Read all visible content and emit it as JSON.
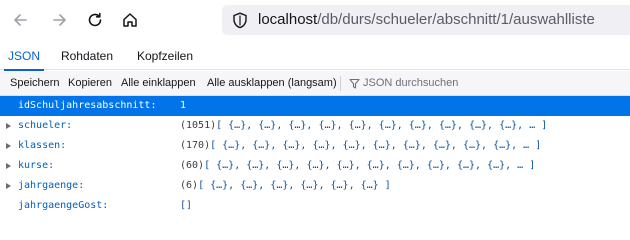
{
  "browser": {
    "url_host": "localhost",
    "url_path": "/db/durs/schueler/abschnitt/1/auswahlliste"
  },
  "viewer": {
    "tabs": [
      {
        "label": "JSON",
        "active": true
      },
      {
        "label": "Rohdaten",
        "active": false
      },
      {
        "label": "Kopfzeilen",
        "active": false
      }
    ],
    "toolbar": {
      "save": "Speichern",
      "copy": "Kopieren",
      "collapse_all": "Alle einklappen",
      "expand_all": "Alle ausklappen (langsam)",
      "filter_placeholder": "JSON durchsuchen"
    }
  },
  "json_tree": {
    "rows": [
      {
        "key": "idSchuljahresabschnitt:",
        "count": "",
        "value": "1",
        "expandable": false,
        "selected": true
      },
      {
        "key": "schueler:",
        "count": "(1051)",
        "value": "[ {…}, {…}, {…}, {…}, {…}, {…}, {…}, {…}, {…}, {…}, … ]",
        "expandable": true,
        "selected": false
      },
      {
        "key": "klassen:",
        "count": "(170)",
        "value": "[ {…}, {…}, {…}, {…}, {…}, {…}, {…}, {…}, {…}, {…}, … ]",
        "expandable": true,
        "selected": false
      },
      {
        "key": "kurse:",
        "count": "(60)",
        "value": "[ {…}, {…}, {…}, {…}, {…}, {…}, {…}, {…}, {…}, {…}, … ]",
        "expandable": true,
        "selected": false
      },
      {
        "key": "jahrgaenge:",
        "count": "(6)",
        "value": "[ {…}, {…}, {…}, {…}, {…}, {…} ]",
        "expandable": true,
        "selected": false
      },
      {
        "key": "jahrgaengeGost:",
        "count": "",
        "value": "[]",
        "expandable": false,
        "selected": false
      }
    ]
  },
  "colors": {
    "accent": "#0a62d0",
    "selection": "#0074e8",
    "key": "#0060c0"
  },
  "icons": [
    "back-arrow-icon",
    "forward-arrow-icon",
    "reload-icon",
    "home-icon",
    "shield-icon",
    "filter-icon",
    "expand-triangle-icon"
  ]
}
